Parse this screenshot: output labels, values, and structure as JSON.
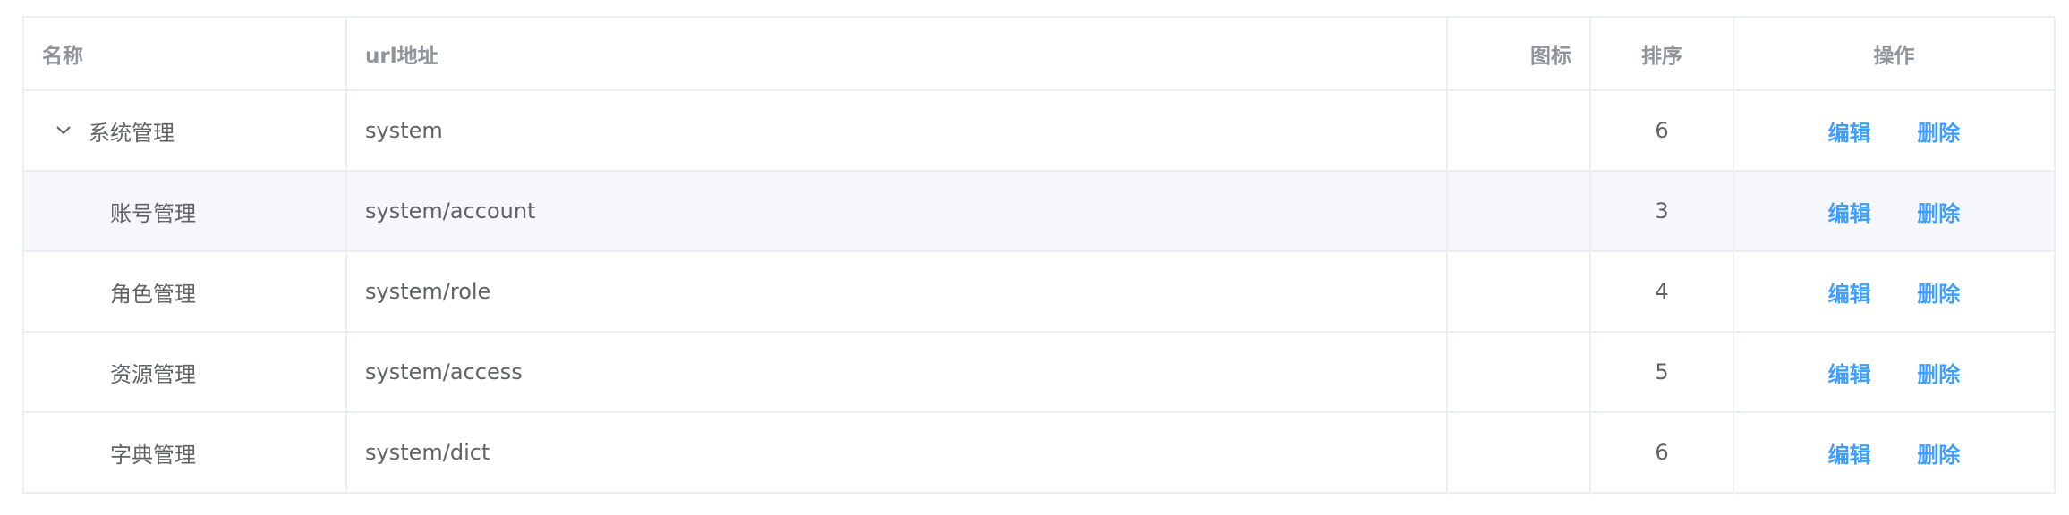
{
  "table": {
    "headers": {
      "name": "名称",
      "url": "url地址",
      "icon": "图标",
      "sort": "排序",
      "actions": "操作"
    },
    "action_labels": {
      "edit": "编辑",
      "delete": "删除"
    },
    "rows": [
      {
        "name": "系统管理",
        "url": "system",
        "icon": "",
        "sort": "6",
        "level": 0,
        "expanded": true
      },
      {
        "name": "账号管理",
        "url": "system/account",
        "icon": "",
        "sort": "3",
        "level": 1,
        "hovered": true
      },
      {
        "name": "角色管理",
        "url": "system/role",
        "icon": "",
        "sort": "4",
        "level": 1
      },
      {
        "name": "资源管理",
        "url": "system/access",
        "icon": "",
        "sort": "5",
        "level": 1
      },
      {
        "name": "字典管理",
        "url": "system/dict",
        "icon": "",
        "sort": "6",
        "level": 1
      }
    ]
  },
  "colors": {
    "link": "#409eff",
    "header_text": "#909399",
    "cell_text": "#606266",
    "border": "#ebeef5",
    "hover_bg": "#f5f7fa"
  }
}
